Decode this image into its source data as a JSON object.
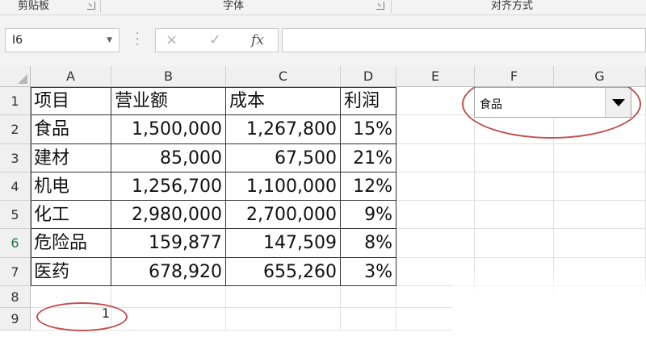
{
  "ribbon": {
    "groups": [
      "剪贴板",
      "字体",
      "对齐方式"
    ]
  },
  "formula_bar": {
    "name_box": "I6",
    "cancel_icon": "×",
    "enter_icon": "✓",
    "fx_label": "fx",
    "formula": ""
  },
  "sheet": {
    "columns": [
      "A",
      "B",
      "C",
      "D",
      "E",
      "F",
      "G"
    ],
    "rows": [
      "1",
      "2",
      "3",
      "4",
      "5",
      "6",
      "7",
      "8",
      "9"
    ],
    "selected_row": "6",
    "table": [
      [
        "项目",
        "营业额",
        "成本",
        "利润"
      ],
      [
        "食品",
        "1,500,000",
        "1,267,800",
        "15%"
      ],
      [
        "建材",
        "85,000",
        "67,500",
        "21%"
      ],
      [
        "机电",
        "1,256,700",
        "1,100,000",
        "12%"
      ],
      [
        "化工",
        "2,980,000",
        "2,700,000",
        "9%"
      ],
      [
        "危险品",
        "159,877",
        "147,509",
        "8%"
      ],
      [
        "医药",
        "678,920",
        "655,260",
        "3%"
      ]
    ],
    "a9_value": "1"
  },
  "dropdown": {
    "selected": "食品",
    "icon": "dropdown-arrow"
  },
  "colors": {
    "annotation": "#c0504d",
    "selected_row_header": "#217346"
  }
}
